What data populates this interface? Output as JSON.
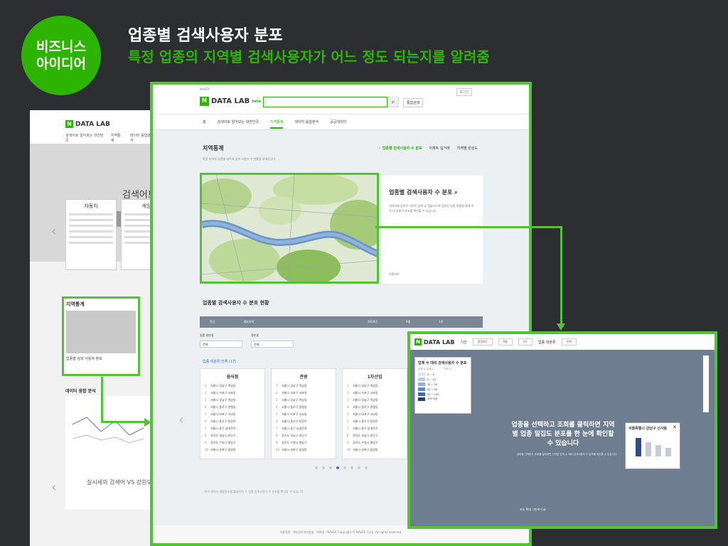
{
  "header": {
    "badge_line1": "비즈니스",
    "badge_line2": "아이디어",
    "title": "업종별 검색사용자 분포",
    "subtitle": "특정 업종의 지역별 검색사용자가 어느 정도 되는지를 알려줌"
  },
  "background_screen": {
    "logo": "DATA LAB",
    "tabs": [
      "검색어로 알아보는 대한민국",
      "지역통계",
      "데이터 융합분석"
    ],
    "hero_title": "검색어트",
    "categories": [
      "자동차",
      "게임"
    ],
    "region_card_title": "지역통계",
    "region_card_text": "업종별 검색 사용자 분포",
    "compare_title": "데이터 융합 분석",
    "compare_caption": "실시세의 검색어 VS 강원도"
  },
  "main_screen": {
    "naver": "NAVER",
    "logo": "DATA LAB",
    "beta": "beta",
    "search_button_icon": "search-icon",
    "detail_button": "통합검색",
    "login": "로그인",
    "tabs": [
      "홈",
      "검색어로 알아보는 대한민국",
      "지역통계",
      "데이터 융합분석",
      "공공데이터"
    ],
    "active_tab": "지역통계",
    "region_title": "지역통계",
    "region_sub": "특정 지역의 업종별 네이버 검색 사용자 수 현황을 보여줍니다.",
    "subtabs": [
      "업종별 검색사용자 수 분포",
      "아파트 실거래",
      "지역별 관심도"
    ],
    "info_title": "업종별 검색사용자 수 분포",
    "info_text": "네이버에 등록된 기프트 업체 및 랩플러스에 검색된 업종 현황을 통해 지역 내 업종의 분포를 확인할 수 있습니다.",
    "info_foot": "더알리기",
    "section2_title": "업종별 검색사용자 수 분포 현황",
    "filterbar": [
      "전국",
      "세부지역",
      "2016년",
      "9월",
      "1주"
    ],
    "filter1_label": "업종 대분류",
    "filter1_value": "전체",
    "filter2_label": "중분류",
    "filter2_value": "전체",
    "count_label": "업종 대분류 전체 (17)",
    "cards": [
      {
        "title": "음식점",
        "rows": [
          "서울시 강남구 역삼동",
          "서울시 서초구 서초동",
          "서울시 강남구 역삼동",
          "서울시 종로구 관철동",
          "서울시 마포구 서교동",
          "서울시 용산구 한강로",
          "서울시 중구 남대문로",
          "경기도 성남시 분당구",
          "경기도 수원시 팔달구",
          "서울시 송파구 잠실동"
        ]
      },
      {
        "title": "관광",
        "rows": [
          "서울시 강남구 역삼동",
          "서울시 서초구 서초동",
          "서울시 강남구 역삼동",
          "서울시 종로구 관철동",
          "서울시 마포구 서교동",
          "서울시 용산구 한강로",
          "서울시 중구 남대문로",
          "경기도 성남시 분당구",
          "경기도 수원시 팔달구",
          "서울시 송파구 잠실동"
        ]
      },
      {
        "title": "1차산업",
        "rows": [
          "서울시 강남구 역삼동",
          "서울시 서초구 서초동",
          "서울시 강남구 역삼동",
          "서울시 종로구 관철동",
          "서울시 마포구 서교동",
          "서울시 용산구 한강로",
          "서울시 중구 남대문로",
          "경기도 성남시 분당구",
          "경기도 수원시 팔달구",
          "서울시 송파구 잠실동"
        ]
      }
    ],
    "note": "· 위치 데이터 현황정보를 활용하여 각 업종 검색사용자 수 분포를 확인할 수 있습니다.",
    "footer": "이용약관 · 개인정보처리방침 · 저작권 · NAVER Copyright © NAVER Corp. All rights reserved."
  },
  "right_screen": {
    "logo": "DATA LAB",
    "selects": [
      "기간",
      "2016년",
      "9월",
      "1주",
      "업종 대분류",
      "전체"
    ],
    "legend_title": "업체 수 대비 검색사용자 수 분포",
    "legend_cols": [
      "업체 당 검색수",
      "지역 수"
    ],
    "legend_rows": [
      "0 ~ 5",
      "5 ~ 10",
      "10 ~ 20",
      "20 ~ 50",
      "50 ~ 100",
      "100 이상"
    ],
    "legend_colors": [
      "#dbe6f4",
      "#b7cde8",
      "#8fb0d9",
      "#5f8bc4",
      "#3c6aa8",
      "#203f7a"
    ],
    "message": "업종을 선택하고 조회를 클릭하면 지역별 업종 밀집도 분포를 한 눈에 확인할 수 있습니다",
    "message_sub": "업종을 선택하고 조회를 클릭하면 지역별 업체 수 대비 검색사용자 수 분포를 확인할 수 있습니다.",
    "popup_title": "서울특별시 강남구 신사동",
    "bottom": "지도 확대 그만보기"
  }
}
